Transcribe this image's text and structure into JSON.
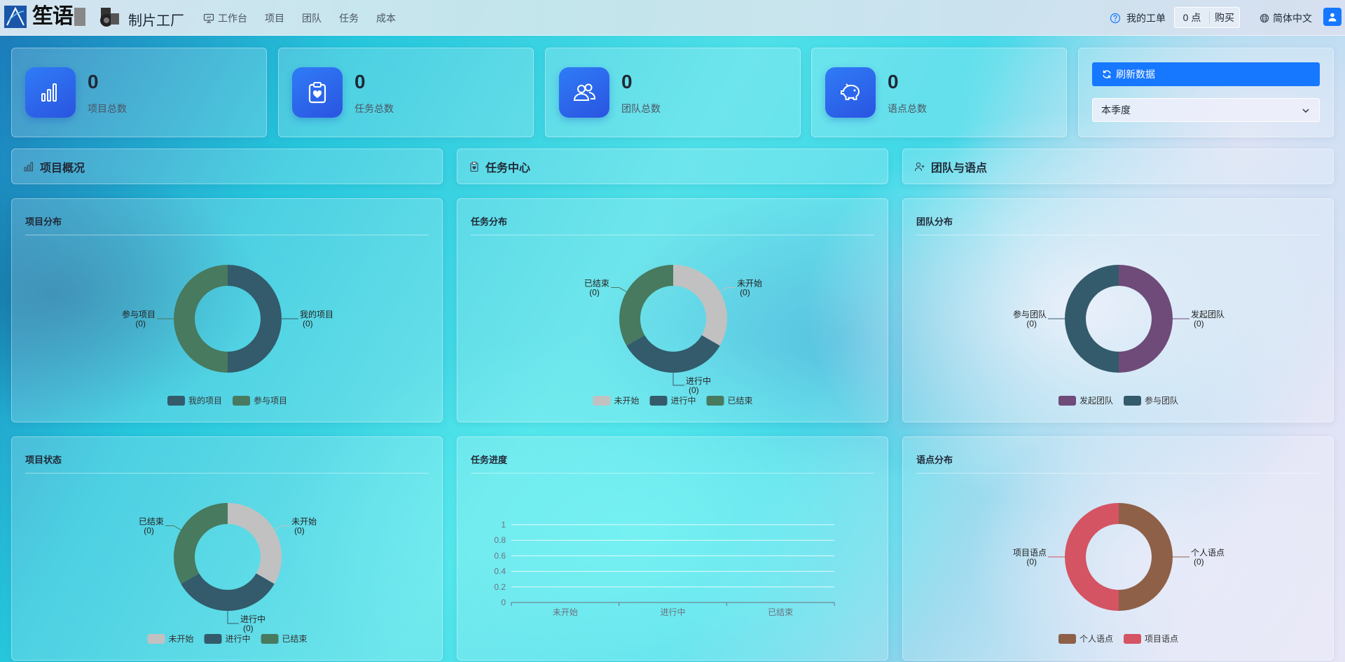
{
  "header": {
    "logo_text": "笙语",
    "app_name": "制片工厂",
    "nav": [
      {
        "label": "工作台",
        "icon": "monitor-icon"
      },
      {
        "label": "项目"
      },
      {
        "label": "团队"
      },
      {
        "label": "任务"
      },
      {
        "label": "成本"
      }
    ],
    "my_tickets": "我的工单",
    "points": "0 点",
    "buy": "购买",
    "language": "简体中文"
  },
  "stats": [
    {
      "value": "0",
      "label": "项目总数",
      "icon": "bar-chart-icon"
    },
    {
      "value": "0",
      "label": "任务总数",
      "icon": "clipboard-heart-icon"
    },
    {
      "value": "0",
      "label": "团队总数",
      "icon": "team-icon"
    },
    {
      "value": "0",
      "label": "语点总数",
      "icon": "piggy-bank-icon"
    }
  ],
  "controls": {
    "refresh_label": "刷新数据",
    "period": "本季度"
  },
  "sections": [
    {
      "title": "项目概况",
      "icon": "bar-chart-icon"
    },
    {
      "title": "任务中心",
      "icon": "clipboard-icon"
    },
    {
      "title": "团队与语点",
      "icon": "user-add-icon"
    }
  ],
  "colors": {
    "accent": "#1677ff",
    "slate": "#335b6b",
    "green": "#487a5f",
    "grey": "#c1c1c1",
    "purple": "#6e4b78",
    "brown": "#8e6048",
    "red": "#d45463"
  },
  "charts": [
    {
      "title": "项目分布",
      "chart_data": {
        "type": "pie",
        "slices": [
          {
            "name": "我的项目",
            "value": 0,
            "color": "#335b6b"
          },
          {
            "name": "参与项目",
            "value": 0,
            "color": "#487a5f"
          }
        ]
      }
    },
    {
      "title": "任务分布",
      "chart_data": {
        "type": "pie",
        "slices": [
          {
            "name": "未开始",
            "value": 0,
            "color": "#c1c1c1"
          },
          {
            "name": "进行中",
            "value": 0,
            "color": "#335b6b"
          },
          {
            "name": "已结束",
            "value": 0,
            "color": "#487a5f"
          }
        ]
      }
    },
    {
      "title": "团队分布",
      "chart_data": {
        "type": "pie",
        "slices": [
          {
            "name": "发起团队",
            "value": 0,
            "color": "#6e4b78"
          },
          {
            "name": "参与团队",
            "value": 0,
            "color": "#335b6b"
          }
        ]
      }
    },
    {
      "title": "项目状态",
      "chart_data": {
        "type": "pie",
        "slices": [
          {
            "name": "未开始",
            "value": 0,
            "color": "#c1c1c1"
          },
          {
            "name": "进行中",
            "value": 0,
            "color": "#335b6b"
          },
          {
            "name": "已结束",
            "value": 0,
            "color": "#487a5f"
          }
        ]
      }
    },
    {
      "title": "任务进度",
      "chart_data": {
        "type": "bar",
        "categories": [
          "未开始",
          "进行中",
          "已结束"
        ],
        "values": [
          0,
          0,
          0
        ],
        "ylim": [
          0,
          1
        ],
        "yticks": [
          "0",
          "0.2",
          "0.4",
          "0.6",
          "0.8",
          "1"
        ]
      }
    },
    {
      "title": "语点分布",
      "chart_data": {
        "type": "pie",
        "slices": [
          {
            "name": "个人语点",
            "value": 0,
            "color": "#8e6048"
          },
          {
            "name": "项目语点",
            "value": 0,
            "color": "#d45463"
          }
        ]
      }
    }
  ]
}
